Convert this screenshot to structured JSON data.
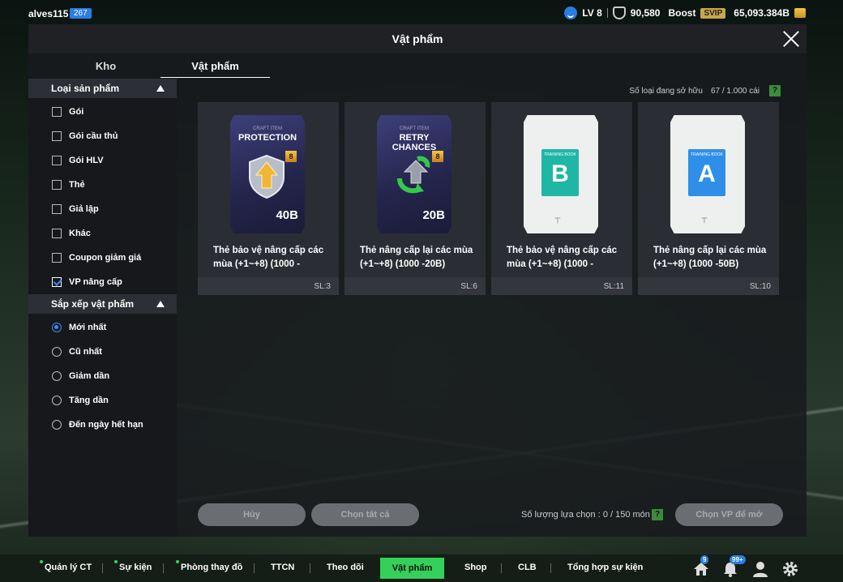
{
  "topbar": {
    "username": "alves115",
    "user_level_badge": "267",
    "level": "LV 8",
    "points": "90,580",
    "boost_label": "Boost",
    "svip_label": "SVIP",
    "coins": "65,093.384B"
  },
  "dialog": {
    "title": "Vật phẩm",
    "tabs": [
      {
        "label": "Kho",
        "active": false
      },
      {
        "label": "Vật phẩm",
        "active": true
      }
    ],
    "owned_label": "Số loại đang sở hữu",
    "owned_value": "67 / 1.000 cái",
    "help_icon": "?"
  },
  "sidebar": {
    "product_type": {
      "title": "Loại sản phẩm",
      "options": [
        {
          "label": "Gói",
          "checked": false
        },
        {
          "label": "Gói cầu thủ",
          "checked": false
        },
        {
          "label": "Gói HLV",
          "checked": false
        },
        {
          "label": "Thẻ",
          "checked": false
        },
        {
          "label": "Giả lập",
          "checked": false
        },
        {
          "label": "Khác",
          "checked": false
        },
        {
          "label": "Coupon giảm giá",
          "checked": false
        },
        {
          "label": "VP nâng cấp",
          "checked": true
        }
      ]
    },
    "sort": {
      "title": "Sắp xếp vật phẩm",
      "options": [
        {
          "label": "Mới nhất",
          "selected": true
        },
        {
          "label": "Cũ nhất",
          "selected": false
        },
        {
          "label": "Giảm dần",
          "selected": false
        },
        {
          "label": "Tăng dần",
          "selected": false
        },
        {
          "label": "Đến ngày hết hạn",
          "selected": false
        }
      ]
    }
  },
  "items": [
    {
      "name": "Thẻ bảo vệ nâng cấp các mùa (+1~+8) (1000 -",
      "qty": "SL:3",
      "image": {
        "kind": "craft",
        "small": "CRAFT ITEM",
        "big": "PROTECTION",
        "badge": "8",
        "value": "40B",
        "icon": "shield-arrow-icon"
      }
    },
    {
      "name": "Thẻ nâng cấp lại các mùa (+1~+8) (1000 -20B)",
      "qty": "SL:6",
      "image": {
        "kind": "craft",
        "small": "CRAFT ITEM",
        "big": "RETRY CHANCES",
        "badge": "8",
        "value": "20B",
        "icon": "retry-arrows-icon"
      }
    },
    {
      "name": "Thẻ bảo vệ nâng cấp các mùa (+1~+8) (1000 -",
      "qty": "SL:11",
      "image": {
        "kind": "book",
        "tag": "TRAINING BOOK",
        "letter": "B",
        "color": "#1fb6a6"
      }
    },
    {
      "name": "Thẻ nâng cấp lại các mùa (+1~+8) (1000 -50B)",
      "qty": "SL:10",
      "image": {
        "kind": "book",
        "tag": "TRAINING BOOK",
        "letter": "A",
        "color": "#2f8fe8"
      }
    }
  ],
  "actions": {
    "cancel": "Hủy",
    "select_all": "Chọn tất cả",
    "selection_count": "Số lượng lựa chọn : 0 / 150 món",
    "open_selected": "Chọn VP để mở"
  },
  "nav": {
    "items": [
      "Quản lý CT",
      "Sự kiện",
      "Phòng thay đồ",
      "TTCN",
      "Theo dõi",
      "Vật phẩm",
      "Shop",
      "CLB",
      "Tổng hợp sự kiện"
    ],
    "active": "Vật phẩm",
    "home_badge": "9",
    "bell_badge": "99+"
  },
  "colors": {
    "accent_green": "#35d05a",
    "checkbox_blue": "#3d8bff",
    "level_badge": "#2a7de1"
  }
}
